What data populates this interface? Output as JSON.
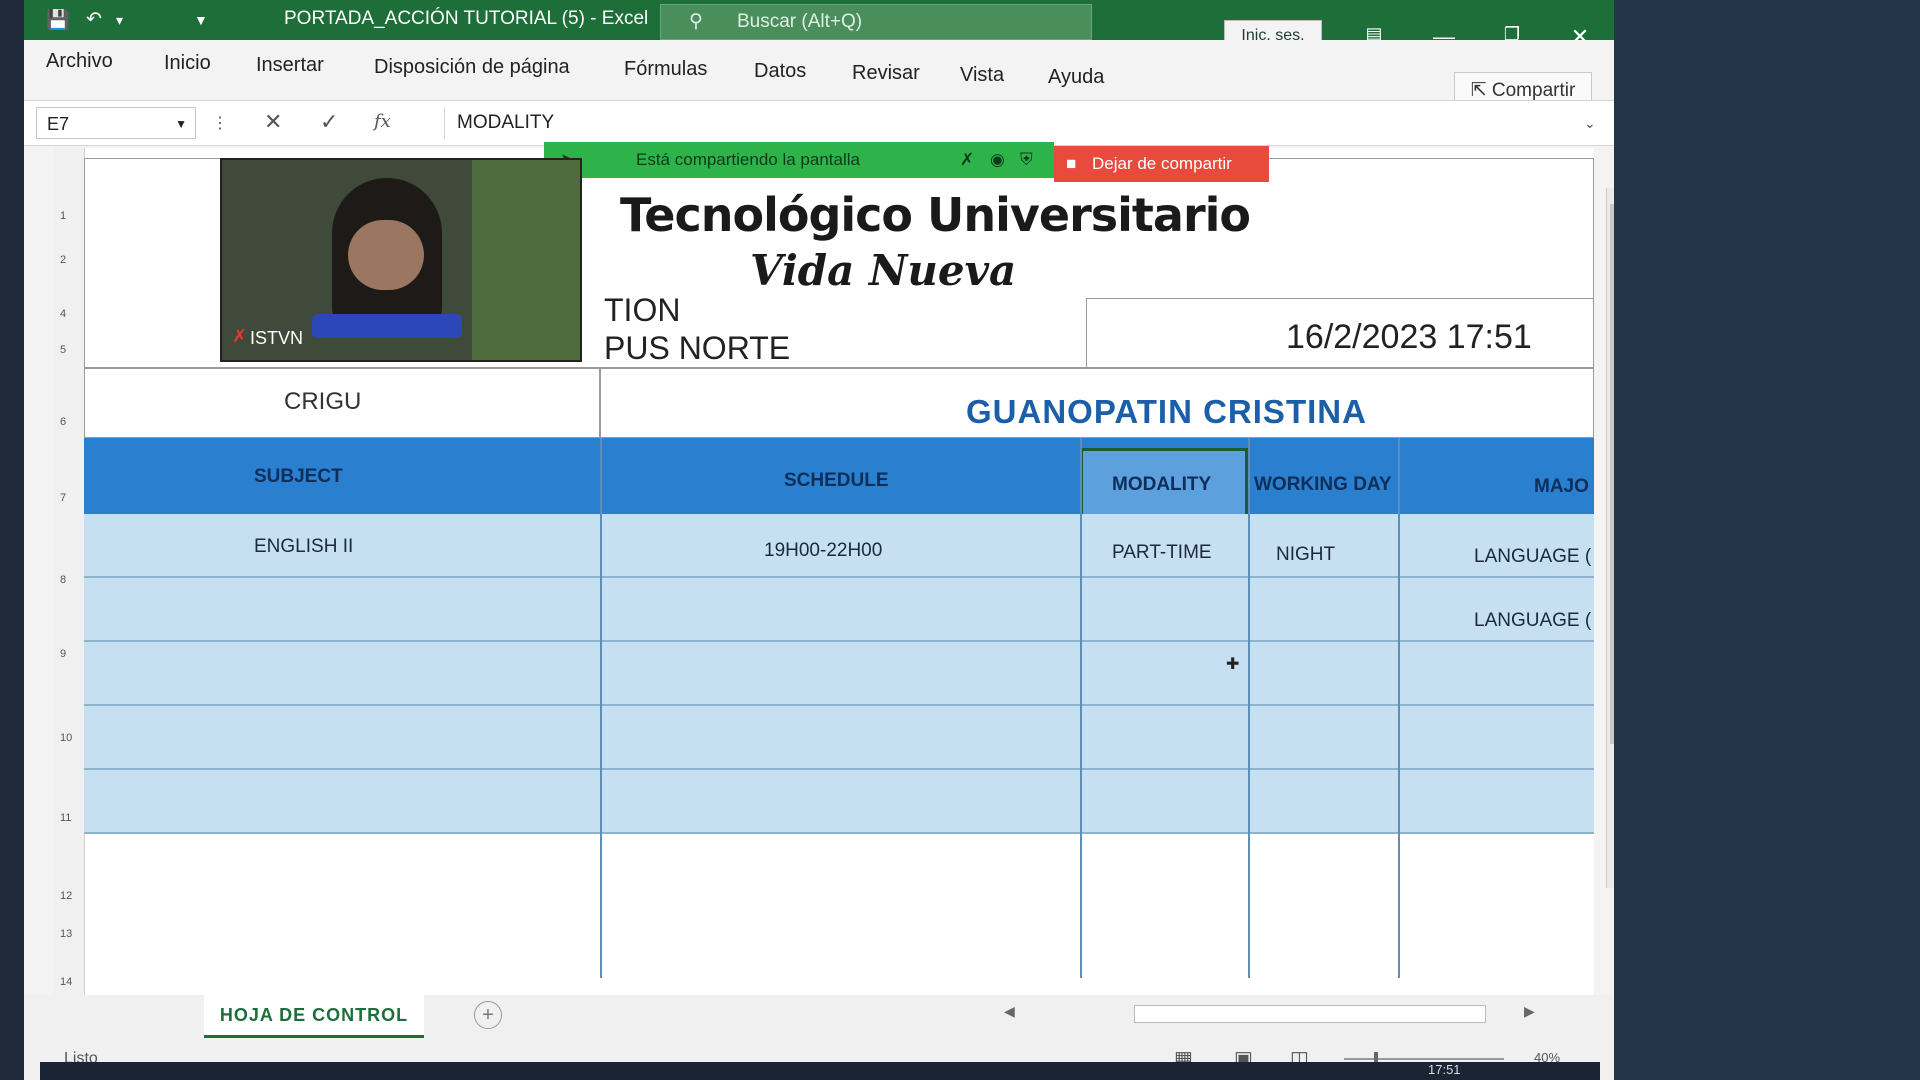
{
  "title_bar": {
    "doc_title": "PORTADA_ACCIÓN TUTORIAL (5)  -  Excel",
    "search_placeholder": "Buscar (Alt+Q)",
    "sign_in": "Inic. ses."
  },
  "ribbon": {
    "tabs": [
      "Archivo",
      "Inicio",
      "Insertar",
      "Disposición de página",
      "Fórmulas",
      "Datos",
      "Revisar",
      "Vista",
      "Ayuda"
    ],
    "share": "Compartir"
  },
  "formula_bar": {
    "name_box": "E7",
    "formula": "MODALITY"
  },
  "screen_share": {
    "notice": "Está compartiendo la pantalla",
    "stop": "Dejar de compartir"
  },
  "webcam": {
    "participant": "ISTVN"
  },
  "sheet": {
    "institution_line1": "Tecnológico Universitario",
    "institution_line2": "Vida Nueva",
    "subtitle1": "TION",
    "subtitle2": "PUS NORTE",
    "datetime": "16/2/2023 17:51",
    "code": "CRIGU",
    "student": "GUANOPATIN CRISTINA",
    "headers": [
      "SUBJECT",
      "SCHEDULE",
      "MODALITY",
      "WORKING DAY",
      "MAJO"
    ],
    "rows": [
      [
        "ENGLISH II",
        "19H00-22H00",
        "PART-TIME",
        "NIGHT",
        "LANGUAGE ("
      ],
      [
        "",
        "",
        "",
        "",
        "LANGUAGE ("
      ],
      [
        "",
        "",
        "",
        "",
        ""
      ],
      [
        "",
        "",
        "",
        "",
        ""
      ],
      [
        "",
        "",
        "",
        "",
        ""
      ]
    ],
    "row_numbers": [
      "1",
      "2",
      "4",
      "5",
      "6",
      "7",
      "8",
      "9",
      "10",
      "11",
      "12",
      "13",
      "14"
    ]
  },
  "sheet_tabs": {
    "active": "HOJA DE CONTROL",
    "add": "+"
  },
  "status": {
    "ready": "Listo",
    "zoom": "40%",
    "clock": "17:51"
  },
  "colors": {
    "excel_green": "#1e6e3a",
    "header_blue": "#2b7fcf",
    "row_blue": "#c6e0f2",
    "student_blue": "#1a5fa8",
    "share_green": "#2eb34a",
    "stop_red": "#e84b3c"
  }
}
